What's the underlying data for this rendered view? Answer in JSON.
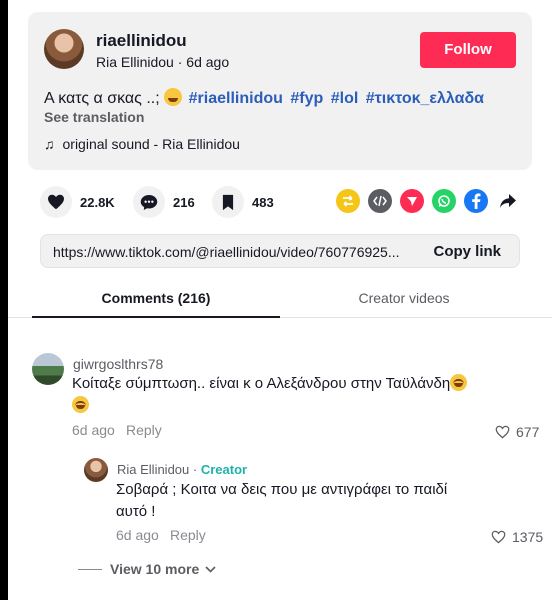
{
  "post": {
    "username": "riaellinidou",
    "display_name": "Ria Ellinidou",
    "time": "6d ago",
    "subline_separator": " · ",
    "follow_label": "Follow",
    "caption_text": "Α κατς α σκας ..;",
    "hashtags": [
      "#riaellinidou",
      "#fyp",
      "#lol",
      "#τικτοκ_ελλαδα"
    ],
    "see_translation": "See translation",
    "sound": "original sound - Ria Ellinidou"
  },
  "actions": {
    "likes": "22.8K",
    "comments": "216",
    "saves": "483"
  },
  "share": {
    "icons": [
      "repost-icon",
      "embed-icon",
      "send-icon",
      "whatsapp-icon",
      "facebook-icon",
      "share-arrow-icon"
    ],
    "colors": {
      "repost": "#f5c518",
      "embed": "#5c5d63",
      "send": "#fe2c55",
      "whatsapp": "#25d366",
      "facebook": "#1877f2"
    }
  },
  "link": {
    "url": "https://www.tiktok.com/@riaellinidou/video/760776925...",
    "copy_label": "Copy link"
  },
  "tabs": {
    "comments": "Comments (216)",
    "creator_videos": "Creator videos"
  },
  "comments": [
    {
      "user": "giwrgoslthrs78",
      "text": "Κοίταξε σύμπτωση.. είναι κ ο Αλεξάνδρου στην Ταϋλάνδη",
      "time": "6d ago",
      "reply_label": "Reply",
      "likes": "677"
    }
  ],
  "reply": {
    "user": "Ria Ellinidou",
    "separator": " · ",
    "creator_label": "Creator",
    "text_line1": "Σοβαρά ; Κοιτα να δεις που με αντιγράφει το παιδί",
    "text_line2": "αυτό !",
    "time": "6d ago",
    "reply_label": "Reply",
    "likes": "1375"
  },
  "view_more": "View 10 more",
  "colors": {
    "accent": "#fe2c55",
    "hashtag": "#2b5db9",
    "creator": "#20b2aa"
  }
}
